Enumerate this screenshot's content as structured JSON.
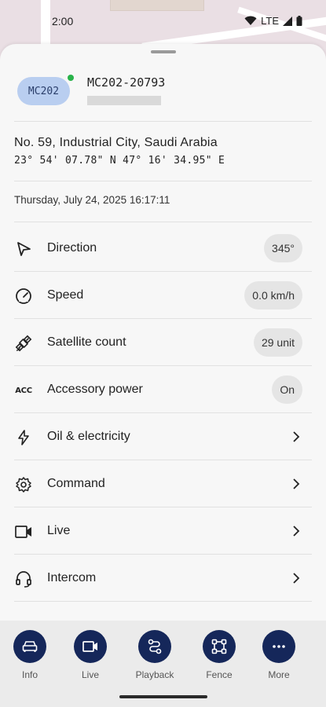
{
  "status": {
    "time": "2:00",
    "network": "LTE"
  },
  "device": {
    "badge": "MC202",
    "name": "MC202-20793",
    "online_color": "#29b34a"
  },
  "location": {
    "address": "No. 59, Industrial City, Saudi Arabia",
    "coords": "23° 54' 07.78\" N 47° 16' 34.95\" E",
    "datetime": "Thursday, July 24, 2025 16:17:11"
  },
  "rows": [
    {
      "label": "Direction",
      "value": "345°",
      "icon": "navigation-arrow-icon"
    },
    {
      "label": "Speed",
      "value": "0.0 km/h",
      "icon": "speedometer-icon"
    },
    {
      "label": "Satellite count",
      "value": "29 unit",
      "icon": "satellite-icon"
    },
    {
      "label": "Accessory power",
      "value": "On",
      "icon": "acc-icon",
      "icon_text": "ACC"
    },
    {
      "label": "Oil & electricity",
      "icon": "lightning-icon"
    },
    {
      "label": "Command",
      "icon": "gear-icon"
    },
    {
      "label": "Live",
      "icon": "video-camera-icon"
    },
    {
      "label": "Intercom",
      "icon": "headset-icon"
    }
  ],
  "nav": [
    {
      "label": "Info",
      "icon": "car-icon"
    },
    {
      "label": "Live",
      "icon": "video-camera-icon"
    },
    {
      "label": "Playback",
      "icon": "route-icon"
    },
    {
      "label": "Fence",
      "icon": "fence-square-icon"
    },
    {
      "label": "More",
      "icon": "more-dots-icon"
    }
  ],
  "colors": {
    "nav_circle": "#15275a",
    "badge_bg": "#b9cef0"
  }
}
